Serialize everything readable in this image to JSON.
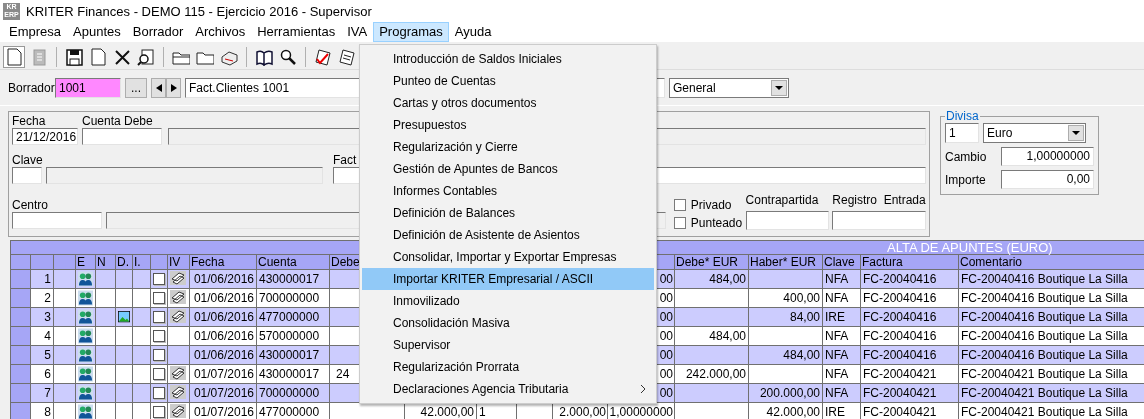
{
  "window": {
    "title": "KRITER Finances - DEMO 115 - Ejercicio 2016 - Supervisor",
    "logo_top": "KR",
    "logo_bottom": "ERP"
  },
  "menu_bar": [
    {
      "label": "Empresa",
      "selected": false
    },
    {
      "label": "Apuntes",
      "selected": false
    },
    {
      "label": "Borrador",
      "selected": false
    },
    {
      "label": "Archivos",
      "selected": false
    },
    {
      "label": "Herramientas",
      "selected": false
    },
    {
      "label": "IVA",
      "selected": false
    },
    {
      "label": "Programas",
      "selected": true
    },
    {
      "label": "Ayuda",
      "selected": false
    }
  ],
  "dropdown_menu": {
    "items": [
      {
        "label": "Introducción de Saldos Iniciales",
        "selected": false,
        "submenu": false
      },
      {
        "label": "Punteo de Cuentas",
        "selected": false,
        "submenu": false
      },
      {
        "label": "Cartas y otros documentos",
        "selected": false,
        "submenu": false
      },
      {
        "label": "Presupuestos",
        "selected": false,
        "submenu": false
      },
      {
        "label": "Regularización y Cierre",
        "selected": false,
        "submenu": false
      },
      {
        "label": "Gestión de Apuntes de Bancos",
        "selected": false,
        "submenu": false
      },
      {
        "label": "Informes Contables",
        "selected": false,
        "submenu": false
      },
      {
        "label": "Definición de Balances",
        "selected": false,
        "submenu": false
      },
      {
        "label": "Definición de Asistente de Asientos",
        "selected": false,
        "submenu": false
      },
      {
        "label": "Consolidar, Importar y Exportar Empresas",
        "selected": false,
        "submenu": false
      },
      {
        "label": "Importar KRITER Empresarial / ASCII",
        "selected": true,
        "submenu": false
      },
      {
        "label": "Inmovilizado",
        "selected": false,
        "submenu": false
      },
      {
        "label": "Consolidación Masiva",
        "selected": false,
        "submenu": false
      },
      {
        "label": "Supervisor",
        "selected": false,
        "submenu": false
      },
      {
        "label": "Regularización Prorrata",
        "selected": false,
        "submenu": false
      },
      {
        "label": "Declaraciones Agencia Tributaria",
        "selected": false,
        "submenu": true
      }
    ]
  },
  "borrador": {
    "label": "Borrador",
    "value": "1001",
    "browse_button": "...",
    "description": "Fact.Clientes 1001",
    "type_select": "General"
  },
  "entry_form": {
    "fecha_label": "Fecha",
    "fecha": "21/12/2016",
    "cuenta_debe_label": "Cuenta Debe",
    "clave_label": "Clave",
    "factura_label": "Fact",
    "centro_label": "Centro",
    "privado": {
      "label": "Privado",
      "checked": false
    },
    "punteado": {
      "label": "Punteado",
      "checked": false
    },
    "contrapartida_label": "Contrapartida",
    "registro_entrada_label": "Registro  Entrada"
  },
  "divisa": {
    "title": "Divisa",
    "code": "1",
    "currency": "Euro",
    "cambio_label": "Cambio",
    "cambio": "1,00000000",
    "importe_label": "Importe",
    "importe": "0,00"
  },
  "table": {
    "title": "ALTA DE APUNTES (EURO)",
    "columns": [
      "E",
      "N",
      "D.",
      "I.",
      "IV",
      "Fecha",
      "Cuenta",
      "Debe",
      "Debe* EUR",
      "Haber* EUR",
      "Clave",
      "Factura",
      "Comentario"
    ],
    "rows": [
      {
        "number": "1",
        "picture": false,
        "checked": false,
        "iva": true,
        "fecha": "01/06/2016",
        "cuenta": "430000017",
        "column_16": "00",
        "debe_eur": "484,00",
        "clave": "NFA",
        "factura": "FC-20040416",
        "comentario": "FC-20040416 Boutique La Silla"
      },
      {
        "number": "2",
        "picture": false,
        "checked": false,
        "iva": true,
        "fecha": "01/06/2016",
        "cuenta": "700000000",
        "column_16": "00",
        "haber_eur": "400,00",
        "clave": "NFA",
        "factura": "FC-20040416",
        "comentario": "FC-20040416 Boutique La Silla"
      },
      {
        "number": "3",
        "picture": true,
        "checked": false,
        "iva": true,
        "fecha": "01/06/2016",
        "cuenta": "477000000",
        "column_16": "00",
        "haber_eur": "84,00",
        "clave": "IRE",
        "factura": "FC-20040416",
        "comentario": "FC-20040416 Boutique La Silla"
      },
      {
        "number": "4",
        "picture": false,
        "checked": false,
        "iva": false,
        "fecha": "01/06/2016",
        "cuenta": "570000000",
        "column_16": "00",
        "debe_eur": "484,00",
        "clave": "NFA",
        "factura": "FC-20040416",
        "comentario": "FC-20040416 Boutique La Silla"
      },
      {
        "number": "5",
        "picture": false,
        "checked": false,
        "iva": false,
        "fecha": "01/06/2016",
        "cuenta": "430000017",
        "column_16": "00",
        "haber_eur": "484,00",
        "clave": "NFA",
        "factura": "FC-20040416",
        "comentario": "FC-20040416 Boutique La Silla"
      },
      {
        "number": "6",
        "picture": false,
        "checked": false,
        "iva": true,
        "fecha": "01/07/2016",
        "cuenta": "430000017",
        "debe": "24",
        "column_16": "00",
        "debe_eur": "242.000,00",
        "clave": "NFA",
        "factura": "FC-20040421",
        "comentario": "FC-20040421 Boutique La Silla"
      },
      {
        "number": "7",
        "picture": false,
        "checked": false,
        "iva": true,
        "fecha": "01/07/2016",
        "cuenta": "700000000",
        "column_16": "00",
        "haber_eur": "200.000,00",
        "clave": "NFA",
        "factura": "FC-20040421",
        "comentario": "FC-20040421 Boutique La Silla"
      },
      {
        "number": "8",
        "picture": false,
        "checked": false,
        "iva": true,
        "fecha": "01/07/2016",
        "cuenta": "477000000",
        "column_12": "42.000,00",
        "column_13": "1",
        "column_15": "2.000,00",
        "column_16": "1,00000000",
        "haber_eur": "42.000,00",
        "clave": "IRE",
        "factura": "FC-20040421",
        "comentario": "FC-20040421 Boutique La Silla"
      }
    ]
  }
}
